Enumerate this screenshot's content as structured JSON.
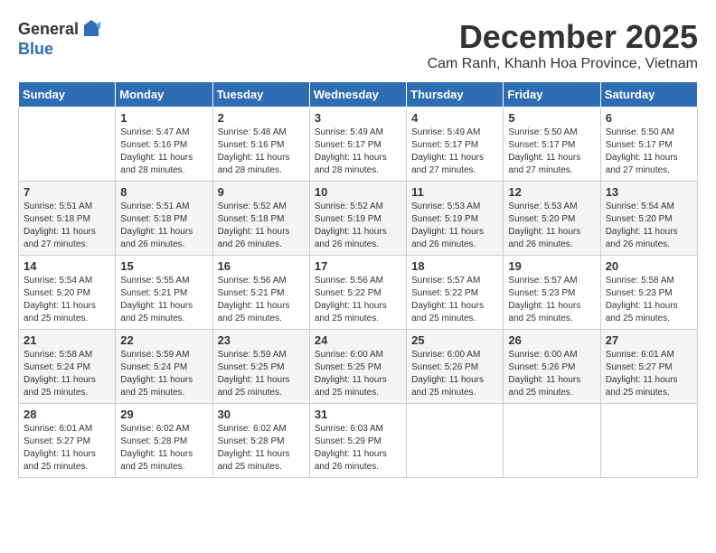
{
  "logo": {
    "general": "General",
    "blue": "Blue"
  },
  "title": {
    "month": "December 2025",
    "location": "Cam Ranh, Khanh Hoa Province, Vietnam"
  },
  "days_of_week": [
    "Sunday",
    "Monday",
    "Tuesday",
    "Wednesday",
    "Thursday",
    "Friday",
    "Saturday"
  ],
  "weeks": [
    [
      {
        "day": "",
        "info": ""
      },
      {
        "day": "1",
        "info": "Sunrise: 5:47 AM\nSunset: 5:16 PM\nDaylight: 11 hours\nand 28 minutes."
      },
      {
        "day": "2",
        "info": "Sunrise: 5:48 AM\nSunset: 5:16 PM\nDaylight: 11 hours\nand 28 minutes."
      },
      {
        "day": "3",
        "info": "Sunrise: 5:49 AM\nSunset: 5:17 PM\nDaylight: 11 hours\nand 28 minutes."
      },
      {
        "day": "4",
        "info": "Sunrise: 5:49 AM\nSunset: 5:17 PM\nDaylight: 11 hours\nand 27 minutes."
      },
      {
        "day": "5",
        "info": "Sunrise: 5:50 AM\nSunset: 5:17 PM\nDaylight: 11 hours\nand 27 minutes."
      },
      {
        "day": "6",
        "info": "Sunrise: 5:50 AM\nSunset: 5:17 PM\nDaylight: 11 hours\nand 27 minutes."
      }
    ],
    [
      {
        "day": "7",
        "info": "Sunrise: 5:51 AM\nSunset: 5:18 PM\nDaylight: 11 hours\nand 27 minutes."
      },
      {
        "day": "8",
        "info": "Sunrise: 5:51 AM\nSunset: 5:18 PM\nDaylight: 11 hours\nand 26 minutes."
      },
      {
        "day": "9",
        "info": "Sunrise: 5:52 AM\nSunset: 5:18 PM\nDaylight: 11 hours\nand 26 minutes."
      },
      {
        "day": "10",
        "info": "Sunrise: 5:52 AM\nSunset: 5:19 PM\nDaylight: 11 hours\nand 26 minutes."
      },
      {
        "day": "11",
        "info": "Sunrise: 5:53 AM\nSunset: 5:19 PM\nDaylight: 11 hours\nand 26 minutes."
      },
      {
        "day": "12",
        "info": "Sunrise: 5:53 AM\nSunset: 5:20 PM\nDaylight: 11 hours\nand 26 minutes."
      },
      {
        "day": "13",
        "info": "Sunrise: 5:54 AM\nSunset: 5:20 PM\nDaylight: 11 hours\nand 26 minutes."
      }
    ],
    [
      {
        "day": "14",
        "info": "Sunrise: 5:54 AM\nSunset: 5:20 PM\nDaylight: 11 hours\nand 25 minutes."
      },
      {
        "day": "15",
        "info": "Sunrise: 5:55 AM\nSunset: 5:21 PM\nDaylight: 11 hours\nand 25 minutes."
      },
      {
        "day": "16",
        "info": "Sunrise: 5:56 AM\nSunset: 5:21 PM\nDaylight: 11 hours\nand 25 minutes."
      },
      {
        "day": "17",
        "info": "Sunrise: 5:56 AM\nSunset: 5:22 PM\nDaylight: 11 hours\nand 25 minutes."
      },
      {
        "day": "18",
        "info": "Sunrise: 5:57 AM\nSunset: 5:22 PM\nDaylight: 11 hours\nand 25 minutes."
      },
      {
        "day": "19",
        "info": "Sunrise: 5:57 AM\nSunset: 5:23 PM\nDaylight: 11 hours\nand 25 minutes."
      },
      {
        "day": "20",
        "info": "Sunrise: 5:58 AM\nSunset: 5:23 PM\nDaylight: 11 hours\nand 25 minutes."
      }
    ],
    [
      {
        "day": "21",
        "info": "Sunrise: 5:58 AM\nSunset: 5:24 PM\nDaylight: 11 hours\nand 25 minutes."
      },
      {
        "day": "22",
        "info": "Sunrise: 5:59 AM\nSunset: 5:24 PM\nDaylight: 11 hours\nand 25 minutes."
      },
      {
        "day": "23",
        "info": "Sunrise: 5:59 AM\nSunset: 5:25 PM\nDaylight: 11 hours\nand 25 minutes."
      },
      {
        "day": "24",
        "info": "Sunrise: 6:00 AM\nSunset: 5:25 PM\nDaylight: 11 hours\nand 25 minutes."
      },
      {
        "day": "25",
        "info": "Sunrise: 6:00 AM\nSunset: 5:26 PM\nDaylight: 11 hours\nand 25 minutes."
      },
      {
        "day": "26",
        "info": "Sunrise: 6:00 AM\nSunset: 5:26 PM\nDaylight: 11 hours\nand 25 minutes."
      },
      {
        "day": "27",
        "info": "Sunrise: 6:01 AM\nSunset: 5:27 PM\nDaylight: 11 hours\nand 25 minutes."
      }
    ],
    [
      {
        "day": "28",
        "info": "Sunrise: 6:01 AM\nSunset: 5:27 PM\nDaylight: 11 hours\nand 25 minutes."
      },
      {
        "day": "29",
        "info": "Sunrise: 6:02 AM\nSunset: 5:28 PM\nDaylight: 11 hours\nand 25 minutes."
      },
      {
        "day": "30",
        "info": "Sunrise: 6:02 AM\nSunset: 5:28 PM\nDaylight: 11 hours\nand 25 minutes."
      },
      {
        "day": "31",
        "info": "Sunrise: 6:03 AM\nSunset: 5:29 PM\nDaylight: 11 hours\nand 26 minutes."
      },
      {
        "day": "",
        "info": ""
      },
      {
        "day": "",
        "info": ""
      },
      {
        "day": "",
        "info": ""
      }
    ]
  ]
}
